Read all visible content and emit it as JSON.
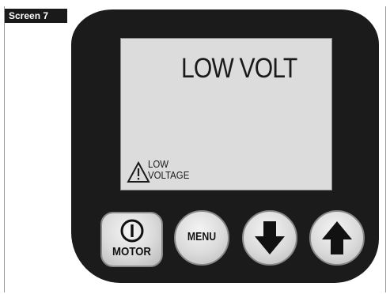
{
  "screen_label": "Screen 7",
  "display": {
    "main_text": "LOW VOLT",
    "warning_line1": "LOW",
    "warning_line2": "VOLTAGE",
    "warning_icon": "warning-triangle-icon"
  },
  "buttons": {
    "motor": {
      "label": "MOTOR",
      "icon": "power-icon"
    },
    "menu": {
      "label": "MENU"
    },
    "down": {
      "icon": "arrow-down-icon"
    },
    "up": {
      "icon": "arrow-up-icon"
    }
  },
  "colors": {
    "device_body": "#1b1b1b",
    "lcd_background": "#dcdcdc",
    "button_face": "#dadada",
    "text": "#111111"
  }
}
